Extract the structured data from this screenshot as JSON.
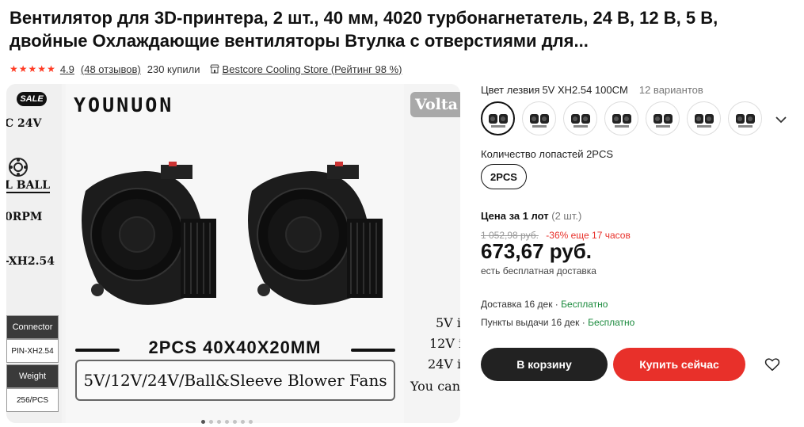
{
  "product": {
    "title": "Вентилятор для 3D-принтера, 2 шт., 40 мм, 4020 турбонагнетатель, 24 В, 12 В, 5 В, двойные Охлаждающие вентиляторы Втулка с отверстиями для..."
  },
  "meta": {
    "stars": 5,
    "rating": "4.9",
    "reviews": "(48 отзывов)",
    "sold": "230 купили",
    "store_icon": "store-icon",
    "store": "Bestcore Cooling Store (Рейтинг 98 %)"
  },
  "gallery": {
    "prev": {
      "sale": "SALE",
      "spec_lines": [
        "C 24V",
        "L BALL",
        "0RPM",
        "-XH2.54"
      ],
      "connector_label": "Connector",
      "connector_value": "PIN-XH2.54",
      "weight_label": "Weight",
      "weight_value": "256/PCS"
    },
    "main": {
      "brand": "YOUNUON",
      "caption1": "2PCS 40X40X20MM",
      "caption2": "5V/12V/24V/Ball&Sleeve Blower Fans"
    },
    "next": {
      "heading": "Volta",
      "lines": [
        "5V i",
        "12V i",
        "24V i",
        "You can"
      ]
    },
    "dots": 7,
    "active_dot": 0
  },
  "variant": {
    "label": "Цвет лезвия",
    "selected": "5V XH2.54 100CM",
    "count": "12 вариантов",
    "swatches_visible": 7,
    "expand_icon": "chevron-down-icon"
  },
  "blades": {
    "label": "Количество лопастей 2PCS",
    "option": "2PCS"
  },
  "price": {
    "label": "Цена за 1 лот",
    "qty": "(2 шт.)",
    "old": "1 052,98 руб.",
    "discount": "-36% еще 17 часов",
    "current": "673,67 руб.",
    "shipping": "есть бесплатная доставка"
  },
  "delivery": {
    "line1_text": "Доставка 16 дек · ",
    "line1_free": "Бесплатно",
    "line2_text": "Пункты выдачи 16 дек · ",
    "line2_free": "Бесплатно"
  },
  "actions": {
    "cart": "В корзину",
    "buy": "Купить сейчас",
    "wishlist_icon": "heart-icon"
  },
  "colors": {
    "accent": "#e8302a",
    "star": "#ff3b24",
    "free": "#1a8a3c",
    "dark_button": "#222222"
  }
}
